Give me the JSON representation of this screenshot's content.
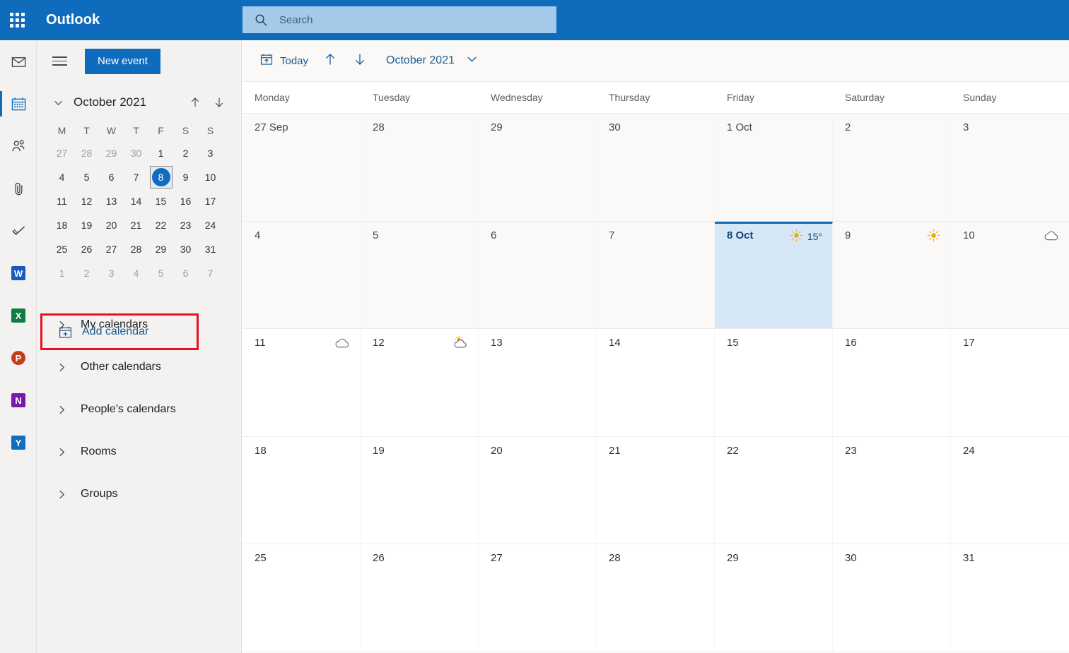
{
  "header": {
    "app_launcher_icon": "waffle-grid-icon",
    "brand": "Outlook",
    "search": {
      "icon": "search-icon",
      "placeholder": "Search",
      "value": ""
    }
  },
  "rail": {
    "items": [
      {
        "name": "mail",
        "icon": "envelope-icon",
        "label": "Mail",
        "selected": false
      },
      {
        "name": "calendar",
        "icon": "calendar-icon",
        "label": "Calendar",
        "selected": true
      },
      {
        "name": "people",
        "icon": "people-icon",
        "label": "People",
        "selected": false
      },
      {
        "name": "files",
        "icon": "paperclip-icon",
        "label": "Files",
        "selected": false
      },
      {
        "name": "to-do",
        "icon": "checkmark-icon",
        "label": "To Do",
        "selected": false
      },
      {
        "name": "word",
        "icon": "word-icon",
        "label": "W",
        "selected": false
      },
      {
        "name": "excel",
        "icon": "excel-icon",
        "label": "X",
        "selected": false
      },
      {
        "name": "powerpoint",
        "icon": "powerpoint-icon",
        "label": "P",
        "selected": false
      },
      {
        "name": "onenote",
        "icon": "onenote-icon",
        "label": "N",
        "selected": false
      },
      {
        "name": "yammer",
        "icon": "yammer-icon",
        "label": "Y",
        "selected": false
      }
    ]
  },
  "nav": {
    "hamburger_icon": "hamburger-menu-icon",
    "new_event_label": "New event",
    "mini_calendar": {
      "collapse_icon": "chevron-down-icon",
      "title": "October 2021",
      "prev_icon": "arrow-up-icon",
      "next_icon": "arrow-down-icon",
      "dow": [
        "M",
        "T",
        "W",
        "T",
        "F",
        "S",
        "S"
      ],
      "weeks": [
        [
          {
            "d": "27",
            "o": true
          },
          {
            "d": "28",
            "o": true
          },
          {
            "d": "29",
            "o": true
          },
          {
            "d": "30",
            "o": true
          },
          {
            "d": "1",
            "o": false
          },
          {
            "d": "2",
            "o": false
          },
          {
            "d": "3",
            "o": false
          }
        ],
        [
          {
            "d": "4",
            "o": false
          },
          {
            "d": "5",
            "o": false
          },
          {
            "d": "6",
            "o": false
          },
          {
            "d": "7",
            "o": false
          },
          {
            "d": "8",
            "o": false,
            "today": true
          },
          {
            "d": "9",
            "o": false
          },
          {
            "d": "10",
            "o": false
          }
        ],
        [
          {
            "d": "11",
            "o": false
          },
          {
            "d": "12",
            "o": false
          },
          {
            "d": "13",
            "o": false
          },
          {
            "d": "14",
            "o": false
          },
          {
            "d": "15",
            "o": false
          },
          {
            "d": "16",
            "o": false
          },
          {
            "d": "17",
            "o": false
          }
        ],
        [
          {
            "d": "18",
            "o": false
          },
          {
            "d": "19",
            "o": false
          },
          {
            "d": "20",
            "o": false
          },
          {
            "d": "21",
            "o": false
          },
          {
            "d": "22",
            "o": false
          },
          {
            "d": "23",
            "o": false
          },
          {
            "d": "24",
            "o": false
          }
        ],
        [
          {
            "d": "25",
            "o": false
          },
          {
            "d": "26",
            "o": false
          },
          {
            "d": "27",
            "o": false
          },
          {
            "d": "28",
            "o": false
          },
          {
            "d": "29",
            "o": false
          },
          {
            "d": "30",
            "o": false
          },
          {
            "d": "31",
            "o": false
          }
        ],
        [
          {
            "d": "1",
            "o": true
          },
          {
            "d": "2",
            "o": true
          },
          {
            "d": "3",
            "o": true
          },
          {
            "d": "4",
            "o": true
          },
          {
            "d": "5",
            "o": true
          },
          {
            "d": "6",
            "o": true
          },
          {
            "d": "7",
            "o": true
          }
        ]
      ]
    },
    "add_calendar": {
      "icon": "calendar-add-icon",
      "label": "Add calendar",
      "highlighted": true,
      "highlight_color": "#e81123"
    },
    "calendar_groups": [
      {
        "icon": "chevron-right-icon",
        "label": "My calendars"
      },
      {
        "icon": "chevron-right-icon",
        "label": "Other calendars"
      },
      {
        "icon": "chevron-right-icon",
        "label": "People's calendars"
      },
      {
        "icon": "chevron-right-icon",
        "label": "Rooms"
      },
      {
        "icon": "chevron-right-icon",
        "label": "Groups"
      }
    ]
  },
  "toolbar": {
    "today_icon": "calendar-today-icon",
    "today_label": "Today",
    "prev_icon": "arrow-up-icon",
    "next_icon": "arrow-down-icon",
    "month_label": "October 2021",
    "month_chevron_icon": "chevron-down-icon"
  },
  "calendar": {
    "day_headers": [
      "Monday",
      "Tuesday",
      "Wednesday",
      "Thursday",
      "Friday",
      "Saturday",
      "Sunday"
    ],
    "weeks": [
      {
        "shaded": true,
        "days": [
          {
            "label": "27 Sep"
          },
          {
            "label": "28"
          },
          {
            "label": "29"
          },
          {
            "label": "30"
          },
          {
            "label": "1 Oct"
          },
          {
            "label": "2"
          },
          {
            "label": "3"
          }
        ]
      },
      {
        "shaded": true,
        "days": [
          {
            "label": "4"
          },
          {
            "label": "5"
          },
          {
            "label": "6"
          },
          {
            "label": "7"
          },
          {
            "label": "8 Oct",
            "selected": true,
            "weather": "sunny-icon",
            "temp": "15°"
          },
          {
            "label": "9",
            "weather": "sunny-icon"
          },
          {
            "label": "10",
            "weather": "cloudy-icon"
          }
        ]
      },
      {
        "shaded": false,
        "days": [
          {
            "label": "11",
            "weather": "cloudy-icon"
          },
          {
            "label": "12",
            "weather": "partly-cloudy-icon"
          },
          {
            "label": "13"
          },
          {
            "label": "14"
          },
          {
            "label": "15"
          },
          {
            "label": "16"
          },
          {
            "label": "17"
          }
        ]
      },
      {
        "shaded": false,
        "days": [
          {
            "label": "18"
          },
          {
            "label": "19"
          },
          {
            "label": "20"
          },
          {
            "label": "21"
          },
          {
            "label": "22"
          },
          {
            "label": "23"
          },
          {
            "label": "24"
          }
        ]
      },
      {
        "shaded": false,
        "days": [
          {
            "label": "25"
          },
          {
            "label": "26"
          },
          {
            "label": "27"
          },
          {
            "label": "28"
          },
          {
            "label": "29"
          },
          {
            "label": "30"
          },
          {
            "label": "31"
          }
        ]
      }
    ]
  },
  "colors": {
    "brand_blue": "#0f6cbd",
    "header_blue": "#0f6cbd",
    "search_bg": "#a5c9e8",
    "nav_bg": "#f3f2f1",
    "selected_day_bg": "#d6e8f8",
    "highlight_red": "#e81123",
    "link_blue": "#1b5b8f",
    "sun_yellow": "#f0ad00"
  }
}
